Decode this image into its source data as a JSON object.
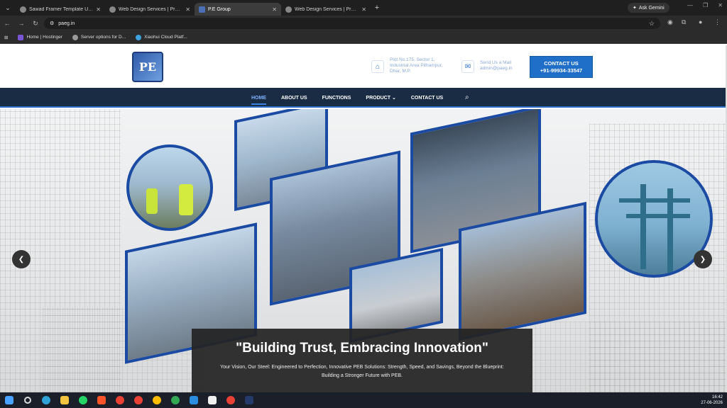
{
  "browser": {
    "tabs": [
      {
        "title": "Sawad Framer Template Usage",
        "active": false
      },
      {
        "title": "Web Design Services | Professio",
        "active": false
      },
      {
        "title": "P.E Group",
        "active": true
      },
      {
        "title": "Web Design Services | Professio",
        "active": false
      }
    ],
    "gemini_label": "Ask Gemini",
    "url": "paeg.in",
    "bookmarks": [
      {
        "label": "Home | Hostinger",
        "icon": "hostinger-icon"
      },
      {
        "label": "Server options for D...",
        "icon": "globe-icon"
      },
      {
        "label": "Xiaohui Cloud Platf...",
        "icon": "cloud-icon"
      }
    ]
  },
  "header": {
    "logo_text": "PE",
    "address": {
      "line1": "Plot No.175, Sector 1,",
      "line2": "Industrial Area Pithampur,",
      "line3": "Dhar, M.P."
    },
    "mail": {
      "line1": "Send Us a Mail",
      "line2": "admin@paeg.in"
    },
    "contact_button": {
      "line1": "CONTACT US",
      "line2": "+91-99934-33547"
    }
  },
  "nav": {
    "items": [
      "HOME",
      "ABOUT US",
      "FUNCTIONS",
      "PRODUCT ⌄",
      "CONTACT US"
    ],
    "active_index": 0
  },
  "hero": {
    "headline": "\"Building Trust, Embracing Innovation\"",
    "subtext_line1": "Your Vision, Our Steel: Engineered to Perfection, Innovative PEB Solutions: Strength, Speed, and Savings, Beyond the Blueprint:",
    "subtext_line2": "Building a Stronger Future with PEB."
  },
  "taskbar": {
    "time": "16:42",
    "date": "27-06-2026"
  },
  "colors": {
    "accent_blue": "#1f6ec7",
    "nav_bg": "#1a2c44",
    "frame_blue": "#1b4aa3"
  }
}
